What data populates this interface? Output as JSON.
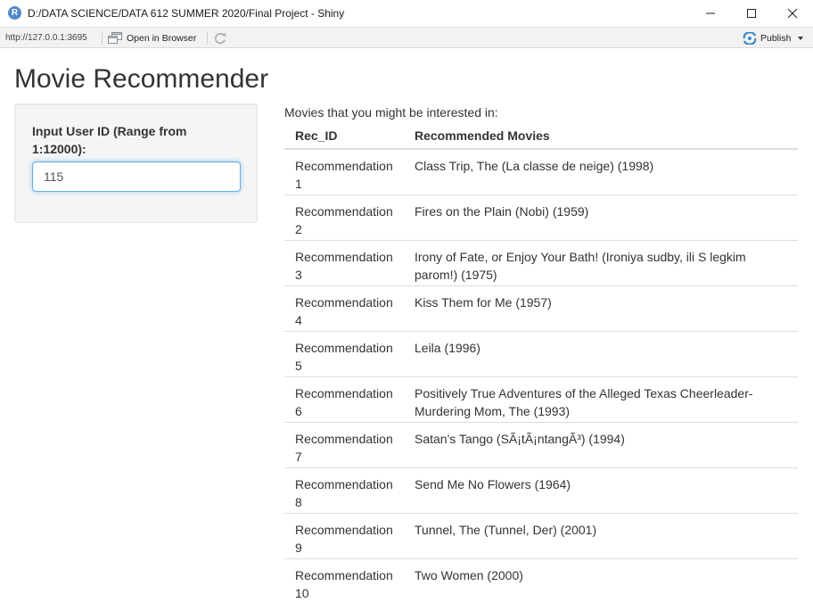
{
  "window": {
    "app_icon_letter": "R",
    "title": "D:/DATA SCIENCE/DATA 612 SUMMER 2020/Final Project - Shiny"
  },
  "toolbar": {
    "url": "http://127.0.0.1:3695",
    "open_in_browser_label": "Open in Browser",
    "publish_label": "Publish",
    "icons": [
      "open-in-browser-icon",
      "refresh-icon",
      "publish-icon",
      "chevron-down-icon"
    ]
  },
  "app": {
    "title": "Movie Recommender",
    "input": {
      "label": "Input User ID (Range from 1:12000):",
      "value": "115"
    },
    "caption": "Movies that you might be interested in:",
    "table": {
      "headers": [
        "Rec_ID",
        "Recommended Movies"
      ],
      "rows": [
        {
          "rec_id": "Recommendation 1",
          "movie": "Class Trip, The (La classe de neige) (1998)"
        },
        {
          "rec_id": "Recommendation 2",
          "movie": "Fires on the Plain (Nobi) (1959)"
        },
        {
          "rec_id": "Recommendation 3",
          "movie": "Irony of Fate, or Enjoy Your Bath! (Ironiya sudby, ili S legkim parom!) (1975)"
        },
        {
          "rec_id": "Recommendation 4",
          "movie": "Kiss Them for Me (1957)"
        },
        {
          "rec_id": "Recommendation 5",
          "movie": "Leila (1996)"
        },
        {
          "rec_id": "Recommendation 6",
          "movie": "Positively True Adventures of the Alleged Texas Cheerleader-Murdering Mom, The (1993)"
        },
        {
          "rec_id": "Recommendation 7",
          "movie": "Satan's Tango (SÃ¡tÃ¡ntangÃ³) (1994)"
        },
        {
          "rec_id": "Recommendation 8",
          "movie": "Send Me No Flowers (1964)"
        },
        {
          "rec_id": "Recommendation 9",
          "movie": "Tunnel, The (Tunnel, Der) (2001)"
        },
        {
          "rec_id": "Recommendation 10",
          "movie": "Two Women (2000)"
        }
      ]
    }
  },
  "colors": {
    "accent": "#66afe9",
    "r_icon": "#4f89c9",
    "publish_icon": "#3a87c8",
    "panel_background": "#f5f5f5",
    "table_border": "#dddddd"
  }
}
